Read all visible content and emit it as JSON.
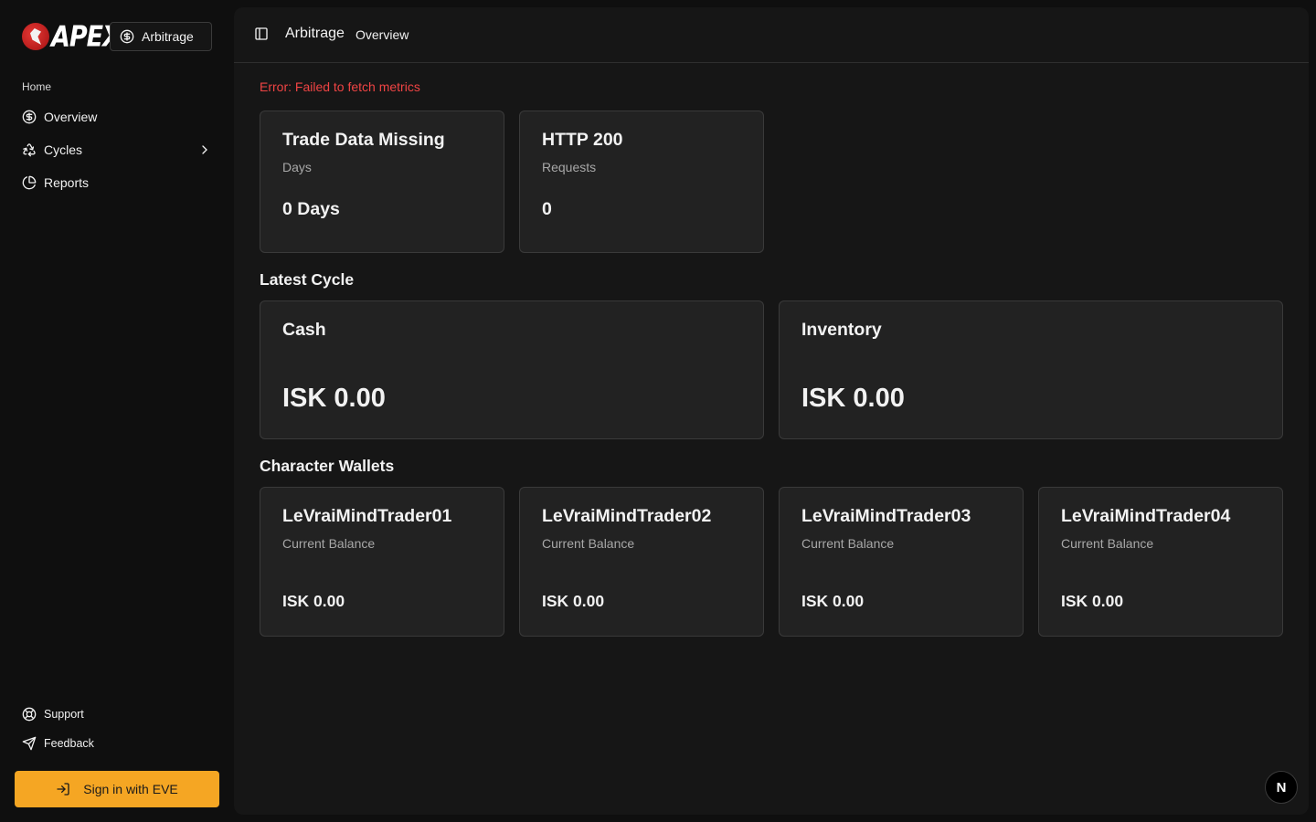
{
  "brand": {
    "logo_text": "APEX",
    "module_label": "Arbitrage"
  },
  "sidebar": {
    "group_label": "Home",
    "items": [
      {
        "label": "Overview",
        "icon": "dollar-circle-icon"
      },
      {
        "label": "Cycles",
        "icon": "recycle-icon",
        "has_submenu": true
      },
      {
        "label": "Reports",
        "icon": "pie-chart-icon"
      }
    ],
    "bottom": [
      {
        "label": "Support",
        "icon": "lifebuoy-icon"
      },
      {
        "label": "Feedback",
        "icon": "send-icon"
      }
    ],
    "signin_label": "Sign in with EVE"
  },
  "header": {
    "breadcrumb_main": "Arbitrage",
    "breadcrumb_sub": "Overview"
  },
  "main": {
    "error": "Error: Failed to fetch metrics",
    "metrics": [
      {
        "title": "Trade Data Missing",
        "subtitle": "Days",
        "value": "0 Days"
      },
      {
        "title": "HTTP 200",
        "subtitle": "Requests",
        "value": "0"
      }
    ],
    "latest_cycle": {
      "title": "Latest Cycle",
      "cards": [
        {
          "title": "Cash",
          "value": "ISK 0.00"
        },
        {
          "title": "Inventory",
          "value": "ISK 0.00"
        }
      ]
    },
    "wallets": {
      "title": "Character Wallets",
      "cards": [
        {
          "name": "LeVraiMindTrader01",
          "subtitle": "Current Balance",
          "value": "ISK 0.00"
        },
        {
          "name": "LeVraiMindTrader02",
          "subtitle": "Current Balance",
          "value": "ISK 0.00"
        },
        {
          "name": "LeVraiMindTrader03",
          "subtitle": "Current Balance",
          "value": "ISK 0.00"
        },
        {
          "name": "LeVraiMindTrader04",
          "subtitle": "Current Balance",
          "value": "ISK 0.00"
        }
      ]
    }
  },
  "colors": {
    "accent": "#f5a623",
    "error": "#ef4444",
    "card_bg": "#222222",
    "panel_bg": "#161616"
  },
  "dev_badge": "N"
}
